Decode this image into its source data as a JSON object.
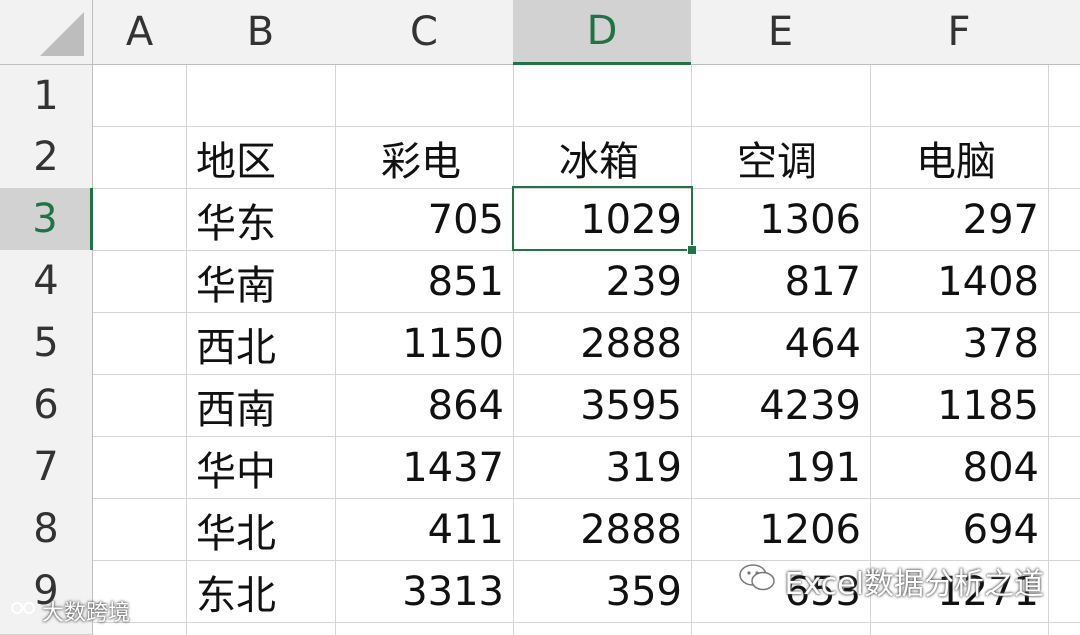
{
  "columns": [
    "A",
    "B",
    "C",
    "D",
    "E",
    "F"
  ],
  "rows": [
    "1",
    "2",
    "3",
    "4",
    "5",
    "6",
    "7",
    "8",
    "9"
  ],
  "header_row": {
    "B": "地区",
    "C": "彩电",
    "D": "冰箱",
    "E": "空调",
    "F": "电脑"
  },
  "data_rows": [
    {
      "region": "华东",
      "c": "705",
      "d": "1029",
      "e": "1306",
      "f": "297"
    },
    {
      "region": "华南",
      "c": "851",
      "d": "239",
      "e": "817",
      "f": "1408"
    },
    {
      "region": "西北",
      "c": "1150",
      "d": "2888",
      "e": "464",
      "f": "378"
    },
    {
      "region": "西南",
      "c": "864",
      "d": "3595",
      "e": "4239",
      "f": "1185"
    },
    {
      "region": "华中",
      "c": "1437",
      "d": "319",
      "e": "191",
      "f": "804"
    },
    {
      "region": "华北",
      "c": "411",
      "d": "2888",
      "e": "1206",
      "f": "694"
    },
    {
      "region": "东北",
      "c": "3313",
      "d": "359",
      "e": "653",
      "f": "1271"
    }
  ],
  "active_cell": "D3",
  "watermark_right": "Excel数据分析之道",
  "watermark_left": "大数跨境",
  "colors": {
    "accent": "#217346",
    "grid": "#d4d4d4",
    "header_bg": "#f2f2f2"
  }
}
